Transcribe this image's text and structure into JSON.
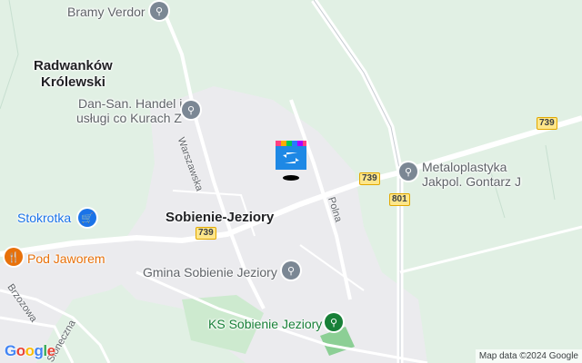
{
  "map": {
    "places": {
      "bramy_verdor": "Bramy Verdor",
      "radwankow_line1": "Radwanków",
      "radwankow_line2": "Królewski",
      "dansan_line1": "Dan-San. Handel i",
      "dansan_line2": "usługi co Kurach Z",
      "metaloplastyka_line1": "Metaloplastyka",
      "metaloplastyka_line2": "Jakpol. Gontarz J",
      "stokrotka": "Stokrotka",
      "sobienie": "Sobienie-Jeziory",
      "pod_jaworem": "Pod Jaworem",
      "gmina": "Gmina Sobienie Jeziory",
      "ks_sobienie": "KS Sobienie Jeziory"
    },
    "streets": {
      "warszawska": "Warszawska",
      "polna": "Polna",
      "brzozowa": "Brzozowa",
      "sloneczna": "Słoneczna"
    },
    "road_shields": {
      "r739_east": "739",
      "r739_center": "739",
      "r739_west": "739",
      "r801": "801"
    },
    "attribution": "Map data ©2024 Google",
    "logo": "Google"
  }
}
